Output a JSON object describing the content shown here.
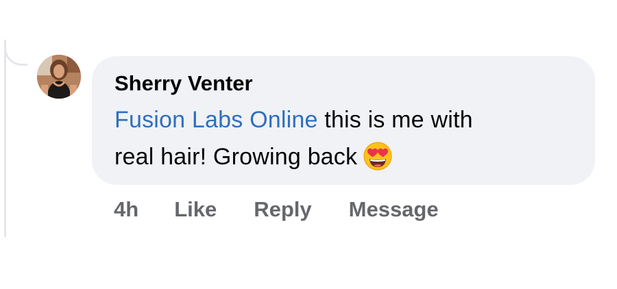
{
  "comment": {
    "author": "Sherry Venter",
    "mention": "Fusion Labs Online",
    "text_line1": " this is me with",
    "text_line2": "real hair! Growing back",
    "emoji": "smiling-face-with-heart-eyes",
    "timestamp": "4h",
    "actions": {
      "like": "Like",
      "reply": "Reply",
      "message": "Message"
    }
  },
  "colors": {
    "bubble_bg": "#f0f2f5",
    "mention": "#2e6fbf",
    "text": "#050505",
    "action_text": "#65676b",
    "emoji_face": "#fcc21b",
    "emoji_heart": "#e8344b"
  }
}
